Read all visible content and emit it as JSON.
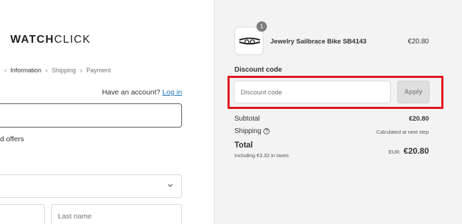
{
  "brand": {
    "bold": "WATCH",
    "light": "CLICK"
  },
  "breadcrumb": {
    "steps": [
      "Information",
      "Shipping",
      "Payment"
    ]
  },
  "account": {
    "prompt": "Have an account?",
    "login_link": "Log in"
  },
  "contact": {
    "offers_text": "d offers"
  },
  "shipping_form": {
    "lastname_placeholder": "Last name"
  },
  "order_summary": {
    "product": {
      "name": "Jewelry Sailbrace Bike SB4143",
      "price": "€20.80",
      "quantity": "1"
    },
    "discount": {
      "label": "Discount code",
      "placeholder": "Discount code",
      "apply_label": "Apply"
    },
    "subtotal": {
      "label": "Subtotal",
      "value": "€20.80"
    },
    "shipping": {
      "label": "Shipping",
      "value": "Calculated at next step"
    },
    "total": {
      "label": "Total",
      "taxes": "Including €3.32 in taxes",
      "currency": "EUR",
      "value": "€20.80"
    }
  },
  "colors": {
    "highlight": "#e0101a",
    "link": "#1a73b5",
    "summary_bg": "#f3f3f3"
  }
}
